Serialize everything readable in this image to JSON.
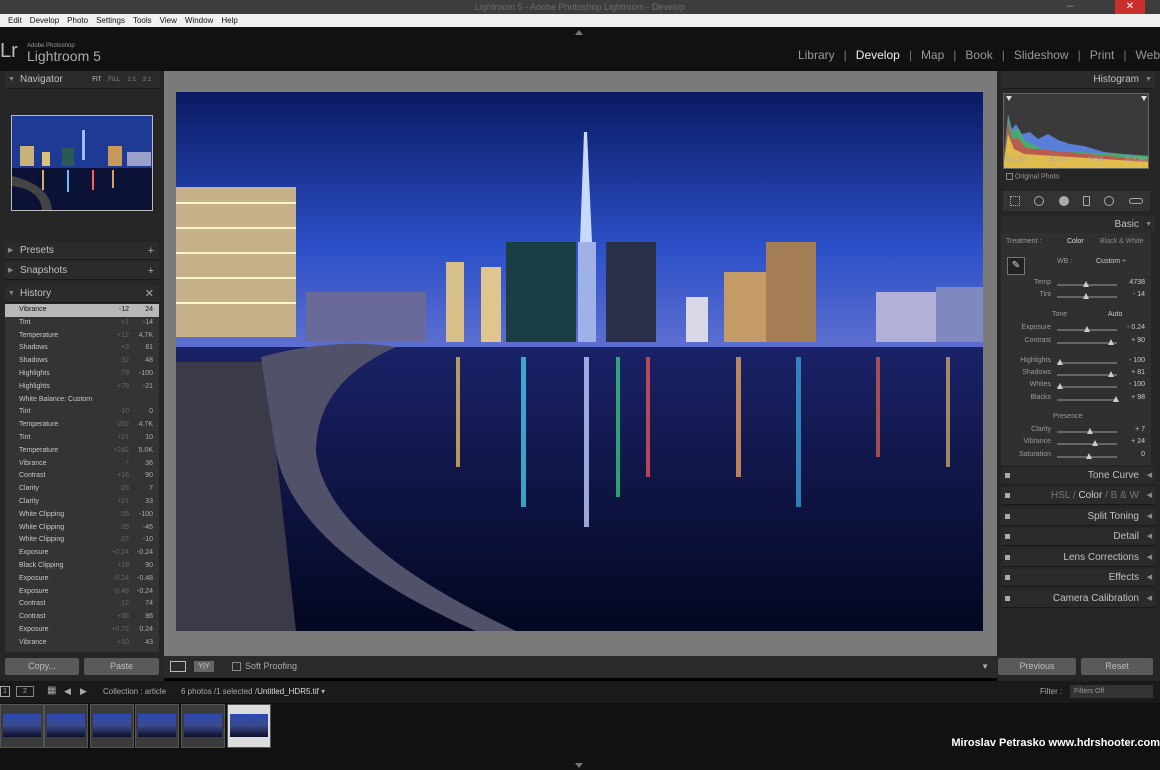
{
  "window": {
    "title": "Lightroom 5 - Adobe Photoshop Lightroom - Develop",
    "close": "✕",
    "minimize": "–"
  },
  "menu": [
    "Edit",
    "Develop",
    "Photo",
    "Settings",
    "Tools",
    "View",
    "Window",
    "Help"
  ],
  "identity": {
    "logo": "Lr",
    "brand_small": "Adobe Photoshop",
    "brand": "Lightroom 5"
  },
  "modules": [
    {
      "label": "Library",
      "active": false
    },
    {
      "label": "Develop",
      "active": true
    },
    {
      "label": "Map",
      "active": false
    },
    {
      "label": "Book",
      "active": false
    },
    {
      "label": "Slideshow",
      "active": false
    },
    {
      "label": "Print",
      "active": false
    },
    {
      "label": "Web",
      "active": false
    }
  ],
  "left": {
    "navigator": {
      "title": "Navigator",
      "options": [
        "FIT",
        "FILL",
        "1:1",
        "3:1"
      ]
    },
    "presets": "Presets",
    "snapshots": "Snapshots",
    "history": {
      "title": "History",
      "items": [
        {
          "name": "Vibrance",
          "before": "-12",
          "after": "24",
          "selected": true
        },
        {
          "name": "Tint",
          "before": "+1",
          "after": "-14"
        },
        {
          "name": "Temperature",
          "before": "+12",
          "after": "4.7K"
        },
        {
          "name": "Shadows",
          "before": "+3",
          "after": "81"
        },
        {
          "name": "Shadows",
          "before": "-32",
          "after": "48"
        },
        {
          "name": "Highlights",
          "before": "-79",
          "after": "-100"
        },
        {
          "name": "Highlights",
          "before": "+79",
          "after": "-21"
        },
        {
          "name": "White Balance: Custom",
          "before": "",
          "after": ""
        },
        {
          "name": "Tint",
          "before": "-10",
          "after": "0"
        },
        {
          "name": "Temperature",
          "before": "-282",
          "after": "4.7K"
        },
        {
          "name": "Tint",
          "before": "+21",
          "after": "10"
        },
        {
          "name": "Temperature",
          "before": "+242",
          "after": "5.0K"
        },
        {
          "name": "Vibrance",
          "before": "-7",
          "after": "36"
        },
        {
          "name": "Contrast",
          "before": "+16",
          "after": "90"
        },
        {
          "name": "Clarity",
          "before": "-26",
          "after": "7"
        },
        {
          "name": "Clarity",
          "before": "+21",
          "after": "33"
        },
        {
          "name": "White Clipping",
          "before": "-55",
          "after": "-100"
        },
        {
          "name": "White Clipping",
          "before": "-35",
          "after": "-45"
        },
        {
          "name": "White Clipping",
          "before": "-27",
          "after": "-10"
        },
        {
          "name": "Exposure",
          "before": "+0.24",
          "after": "-0.24"
        },
        {
          "name": "Black Clipping",
          "before": "+19",
          "after": "90"
        },
        {
          "name": "Exposure",
          "before": "-0.24",
          "after": "-0.48"
        },
        {
          "name": "Exposure",
          "before": "-0.48",
          "after": "-0.24"
        },
        {
          "name": "Contrast",
          "before": "-12",
          "after": "74"
        },
        {
          "name": "Contrast",
          "before": "+36",
          "after": "86"
        },
        {
          "name": "Exposure",
          "before": "+0.72",
          "after": "0.24"
        },
        {
          "name": "Vibrance",
          "before": "+10",
          "after": "43"
        }
      ]
    },
    "copy": "Copy...",
    "paste": "Paste"
  },
  "toolbar": {
    "soft_proofing": "Soft Proofing"
  },
  "right": {
    "histogram": "Histogram",
    "histo_info": [
      "ISO 320",
      "16 mm",
      "f / 5.6",
      "32.0 sec"
    ],
    "original_photo": "Original Photo",
    "basic": "Basic",
    "treatment_label": "Treatment :",
    "treatment_color": "Color",
    "treatment_bw": "Black & White",
    "wb_label": "WB :",
    "wb_value": "Custom ÷",
    "tone_label": "Tone",
    "auto": "Auto",
    "presence": "Presence",
    "sliders": [
      {
        "label": "Temp",
        "value": "4738",
        "pos": 0.45
      },
      {
        "label": "Tint",
        "value": "- 14",
        "pos": 0.45
      },
      {
        "label": "Exposure",
        "value": "- 0.24",
        "pos": 0.48
      },
      {
        "label": "Contrast",
        "value": "+ 90",
        "pos": 0.9
      },
      {
        "label": "Highlights",
        "value": "- 100",
        "pos": 0.0
      },
      {
        "label": "Shadows",
        "value": "+ 81",
        "pos": 0.9
      },
      {
        "label": "Whites",
        "value": "- 100",
        "pos": 0.0
      },
      {
        "label": "Blacks",
        "value": "+ 98",
        "pos": 0.98
      },
      {
        "label": "Clarity",
        "value": "+ 7",
        "pos": 0.53
      },
      {
        "label": "Vibrance",
        "value": "+ 24",
        "pos": 0.62
      },
      {
        "label": "Saturation",
        "value": "0",
        "pos": 0.5
      }
    ],
    "panels": [
      "Tone Curve",
      "Split Toning",
      "Detail",
      "Lens Corrections",
      "Effects",
      "Camera Calibration"
    ],
    "hsl": {
      "hsl": "HSL",
      "color": "Color",
      "bw": "B & W"
    },
    "previous": "Previous",
    "reset": "Reset"
  },
  "filmbar": {
    "page1": "1",
    "page2": "2",
    "collection": "Collection : article",
    "info": "6 photos /1 selected /",
    "filename": "Untitled_HDR5.tif",
    "filter_label": "Filter :",
    "filter_value": "Filters Off"
  },
  "credit": "Miroslav  Petrasko  www.hdrshooter.com"
}
